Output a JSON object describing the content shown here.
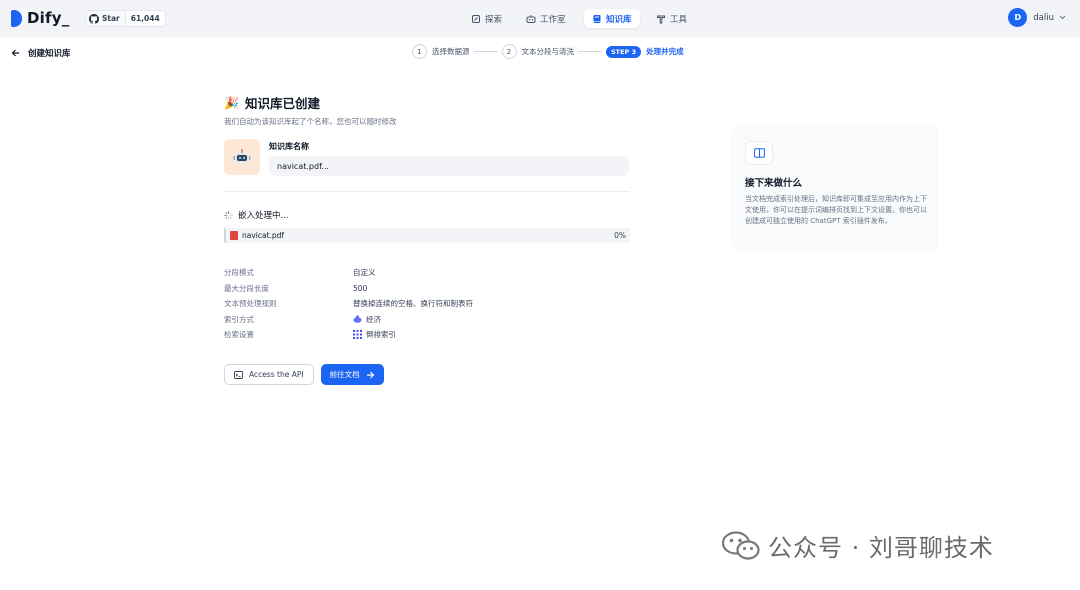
{
  "app": {
    "brand": "Dify",
    "github": {
      "star_label": "Star",
      "star_count": "61,044"
    },
    "nav": [
      {
        "label": "探索",
        "icon": "explore-icon"
      },
      {
        "label": "工作室",
        "icon": "robot-icon"
      },
      {
        "label": "知识库",
        "icon": "book-icon",
        "active": true
      },
      {
        "label": "工具",
        "icon": "tool-icon"
      }
    ],
    "user": {
      "initial": "D",
      "name": "daliu"
    }
  },
  "subheader": {
    "back_label": "创建知识库",
    "steps": [
      {
        "num": "1",
        "label": "选择数据源"
      },
      {
        "num": "2",
        "label": "文本分段与清洗"
      },
      {
        "badge": "STEP 3",
        "label": "处理并完成"
      }
    ]
  },
  "main": {
    "title_emoji": "🎉",
    "title": "知识库已创建",
    "subtitle": "我们自动为该知识库起了个名称，您也可以随时修改",
    "kb_name_label": "知识库名称",
    "kb_name_value": "navicat.pdf...",
    "embedding_title": "嵌入处理中...",
    "file": {
      "name": "navicat.pdf",
      "progress": "0%"
    },
    "properties": [
      {
        "key": "分段模式",
        "value": "自定义"
      },
      {
        "key": "最大分段长度",
        "value": "500"
      },
      {
        "key": "文本预处理规则",
        "value": "替换掉连续的空格、换行符和制表符"
      },
      {
        "key": "索引方式",
        "value": "经济",
        "icon": "economy-icon"
      },
      {
        "key": "检索设置",
        "value": "倒排索引",
        "icon": "grid-icon"
      }
    ],
    "buttons": {
      "api": "Access the API",
      "docs": "前往文档"
    }
  },
  "side": {
    "title": "接下来做什么",
    "text": "当文档完成索引处理后，知识库即可集成至应用内作为上下文使用，你可以在提示词编排页找到上下文设置。你也可以创建成可独立使用的 ChatGPT 索引插件发布。"
  },
  "watermark": {
    "text": "公众号 · 刘哥聊技术"
  },
  "colors": {
    "accent": "#1c64f2",
    "topbar": "#f2f4f7"
  }
}
